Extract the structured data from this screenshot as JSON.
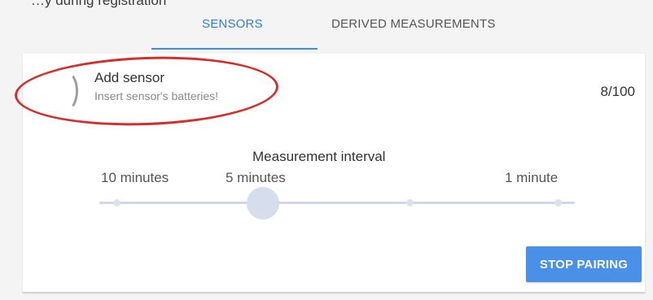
{
  "page": {
    "cut_top_text": "…y during registration"
  },
  "tabs": [
    {
      "label": "SENSORS",
      "active": true
    },
    {
      "label": "DERIVED MEASUREMENTS",
      "active": false
    }
  ],
  "pairing": {
    "title": "Add sensor",
    "subtitle": "Insert sensor's batteries!",
    "counter": "8/100"
  },
  "interval": {
    "title": "Measurement interval",
    "labels": [
      "10 minutes",
      "5 minutes",
      "1 minute"
    ],
    "selected_label": "5 minutes"
  },
  "actions": {
    "stop_label": "STOP PAIRING"
  },
  "colors": {
    "accent": "#3a8ee3",
    "button": "#4a90e8",
    "annotation": "#d22f2f"
  },
  "icons": {
    "loading": "loading-spinner-icon"
  }
}
